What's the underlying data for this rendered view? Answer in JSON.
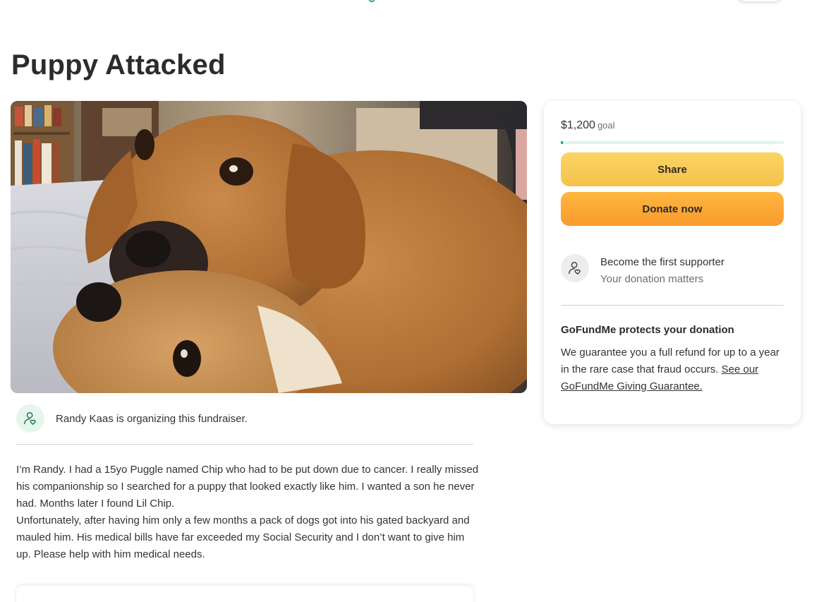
{
  "page": {
    "title": "Puppy Attacked"
  },
  "hero_image": {
    "alt": "Two tan puppies lying together"
  },
  "organizer": {
    "icon": "person-heart-icon",
    "text": "Randy Kaas is organizing this fundraiser."
  },
  "story": {
    "paragraphs": [
      "I’m Randy. I had a 15yo Puggle named Chip who had to be put down due to cancer. I really missed his companionship so I searched for a puppy that looked exactly like him. I wanted a son he never had. Months later I found Lil Chip.",
      "Unfortunately, after having him only a few months a pack of dogs got into his gated backyard and mauled him. His medical bills have far exceeded my Social Security and I don’t want to give him up. Please help with him medical needs."
    ]
  },
  "donation_card": {
    "goal_amount": "$1,200",
    "goal_label": "goal",
    "progress_fraction": 0.01,
    "share_label": "Share",
    "donate_label": "Donate now",
    "supporter_icon": "person-heart-icon",
    "supporter_title": "Become the first supporter",
    "supporter_subtitle": "Your donation matters",
    "protect_title": "GoFundMe protects your donation",
    "protect_body": "We guarantee you a full refund for up to a year in the rare case that fraud occurs.",
    "protect_link": "See our GoFundMe Giving Guarantee."
  },
  "colors": {
    "brand_green": "#02a95c",
    "share_yellow": "#f4c24a",
    "donate_orange": "#f89a2d"
  }
}
